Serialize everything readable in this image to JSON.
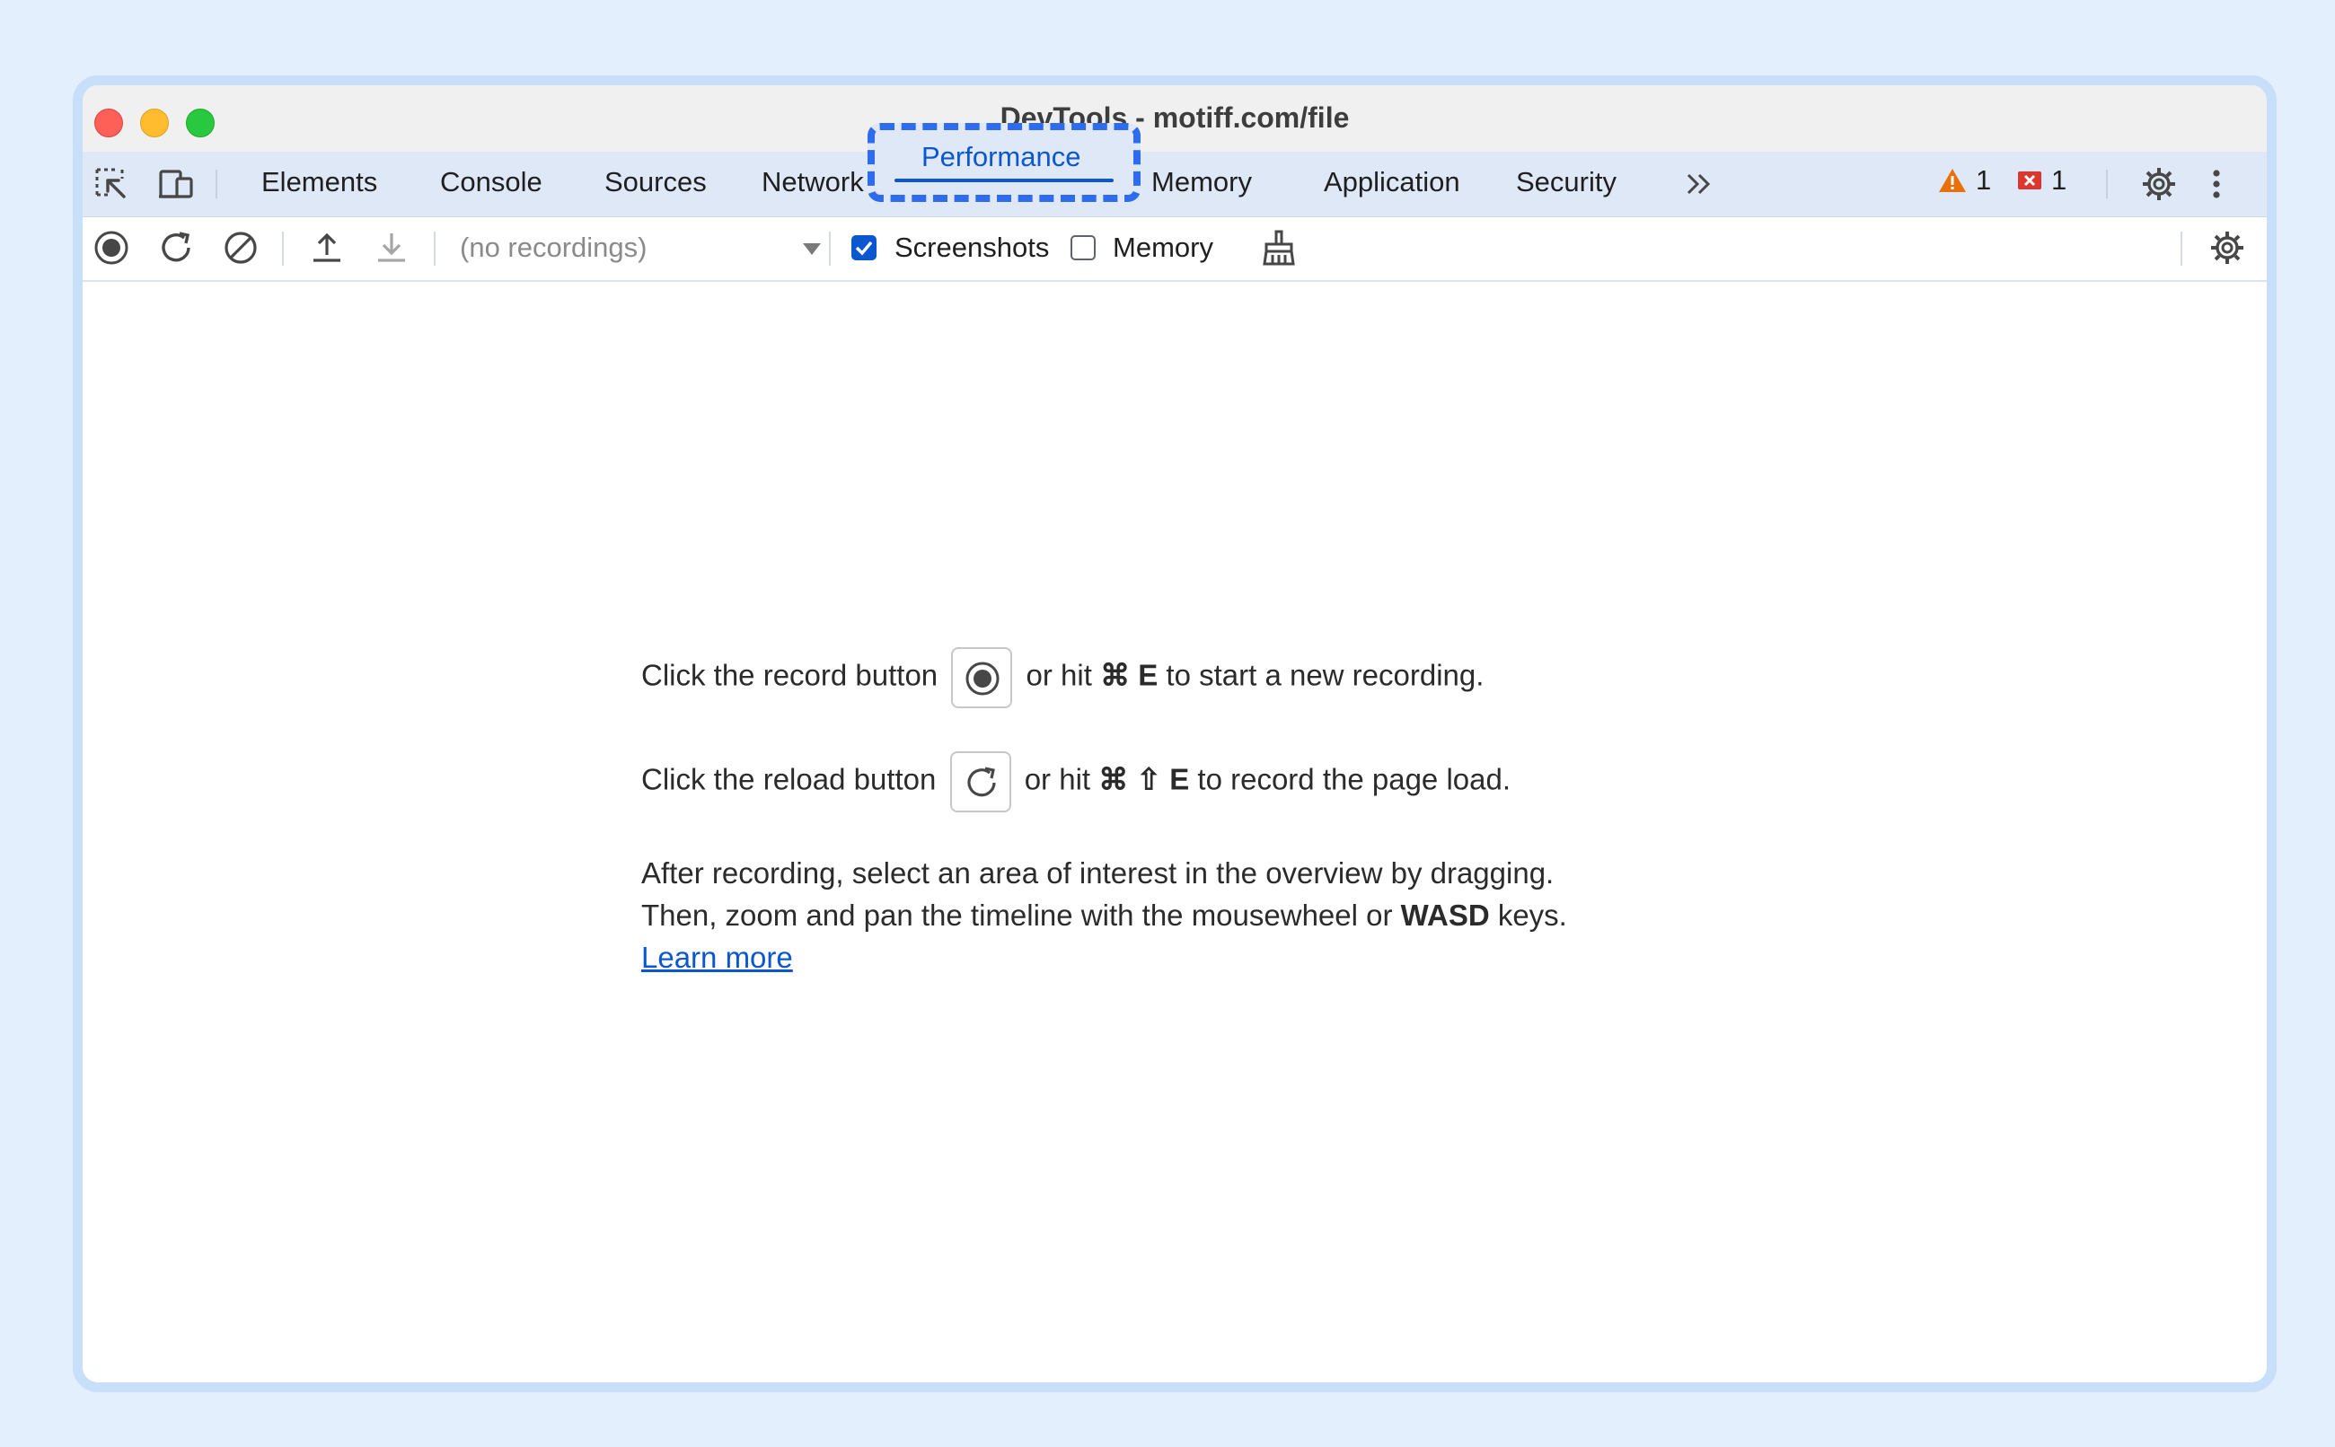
{
  "window": {
    "title": "DevTools - motiff.com/file"
  },
  "tabs": [
    {
      "label": "Elements"
    },
    {
      "label": "Console"
    },
    {
      "label": "Sources"
    },
    {
      "label": "Network"
    },
    {
      "label": "Performance",
      "active": true
    },
    {
      "label": "Memory"
    },
    {
      "label": "Application"
    },
    {
      "label": "Security"
    }
  ],
  "badges": {
    "warnings": "1",
    "errors": "1"
  },
  "toolbar": {
    "recordings_placeholder": "(no recordings)",
    "screenshots_label": "Screenshots",
    "screenshots_checked": true,
    "memory_label": "Memory",
    "memory_checked": false
  },
  "instructions": {
    "record_pre": "Click the record button",
    "record_mid": "or hit",
    "record_shortcut": "⌘ E",
    "record_post": "to start a new recording.",
    "reload_pre": "Click the reload button",
    "reload_mid": "or hit",
    "reload_shortcut": "⌘ ⇧ E",
    "reload_post": "to record the page load.",
    "after_line1": "After recording, select an area of interest in the overview by dragging.",
    "after_line2_pre": "Then, zoom and pan the timeline with the mousewheel or",
    "after_line2_keys": "WASD",
    "after_line2_post": "keys.",
    "learn_more": "Learn more"
  },
  "colors": {
    "accent": "#0b57d0",
    "highlight_border": "#2f6bed",
    "tabbar_bg": "#dfe8f7",
    "warning": "#e8710a",
    "error": "#dc362e"
  }
}
